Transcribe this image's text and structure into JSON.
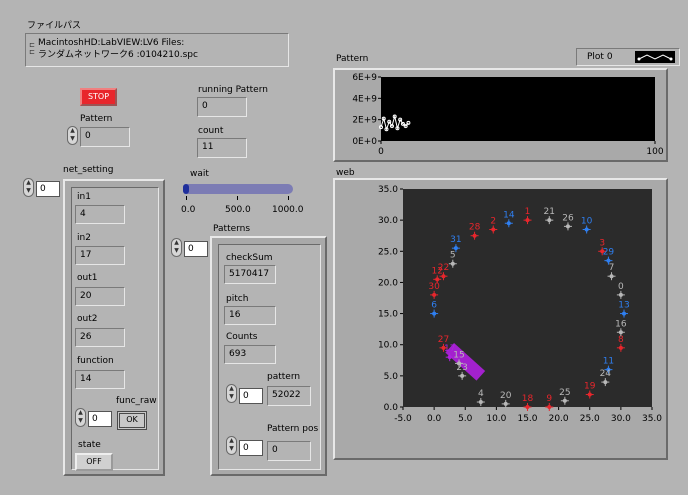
{
  "file_path": {
    "label": "ファイルパス",
    "lines": [
      "MacintoshHD:LabVIEW:LV6 Files:",
      "ランダムネットワーク6 :0104210.spc"
    ]
  },
  "stop_button": {
    "label": "STOP"
  },
  "running_pattern": {
    "label": "running Pattern",
    "value": "0"
  },
  "count": {
    "label": "count",
    "value": "11"
  },
  "pattern_control": {
    "label": "Pattern",
    "value": "0"
  },
  "net_setting": {
    "label": "net_setting",
    "index": "0",
    "in1": {
      "label": "in1",
      "value": "4"
    },
    "in2": {
      "label": "in2",
      "value": "17"
    },
    "out1": {
      "label": "out1",
      "value": "20"
    },
    "out2": {
      "label": "out2",
      "value": "26"
    },
    "function": {
      "label": "function",
      "value": "14"
    },
    "func_raw": {
      "label": "func_raw",
      "value": "0",
      "ok_label": "OK"
    },
    "state": {
      "label": "state",
      "value": "OFF"
    }
  },
  "wait": {
    "label": "wait",
    "ticks": [
      "0.0",
      "500.0",
      "1000.0"
    ],
    "value_fraction": 0.0
  },
  "patterns": {
    "label": "Patterns",
    "index": "0",
    "checksum": {
      "label": "checkSum",
      "value": "5170417"
    },
    "pitch": {
      "label": "pitch",
      "value": "16"
    },
    "counts": {
      "label": "Counts",
      "value": "693"
    },
    "pattern": {
      "label": "pattern",
      "index": "0",
      "value": "52022"
    },
    "pattern_pos": {
      "label": "Pattern pos",
      "index": "0",
      "value": "0"
    }
  },
  "pattern_graph": {
    "label": "Pattern",
    "plot_legend": "Plot 0"
  },
  "web_graph": {
    "label": "web"
  },
  "chart_data": [
    {
      "type": "line",
      "title": "Pattern",
      "xlabel": "",
      "ylabel": "",
      "xlim": [
        0,
        100
      ],
      "ylim": [
        0,
        6000000000.0
      ],
      "x_tick_labels": [
        "0",
        "100"
      ],
      "y_tick_labels": [
        "0E+0",
        "2E+9",
        "4E+9",
        "6E+9"
      ],
      "series": [
        {
          "name": "Plot 0",
          "x": [
            0,
            1,
            2,
            3,
            4,
            5,
            6,
            7,
            8,
            9,
            10
          ],
          "y": [
            1300000000.0,
            2100000000.0,
            1100000000.0,
            1800000000.0,
            1400000000.0,
            2300000000.0,
            1200000000.0,
            2000000000.0,
            1600000000.0,
            1400000000.0,
            1700000000.0
          ]
        }
      ],
      "background": "#000000",
      "line_color": "#ffffff"
    },
    {
      "type": "scatter",
      "title": "web",
      "xlim": [
        -5,
        35
      ],
      "ylim": [
        0,
        35
      ],
      "x_tick_labels": [
        "-5.0",
        "0.0",
        "5.0",
        "10.0",
        "15.0",
        "20.0",
        "25.0",
        "30.0",
        "35.0"
      ],
      "y_tick_labels": [
        "0.0",
        "5.0",
        "10.0",
        "15.0",
        "20.0",
        "25.0",
        "30.0",
        "35.0"
      ],
      "grid": false,
      "background": "#2b2b2b",
      "colors": {
        "red": "#e8262c",
        "blue": "#2f7ff0",
        "gray": "#b8b8b8",
        "purple": "#b020e0"
      },
      "points": [
        {
          "id": "0",
          "x": 30.0,
          "y": 18.0,
          "color": "gray"
        },
        {
          "id": "1",
          "x": 15.0,
          "y": 30.0,
          "color": "red"
        },
        {
          "id": "2",
          "x": 9.5,
          "y": 28.5,
          "color": "red"
        },
        {
          "id": "3",
          "x": 27.0,
          "y": 25.0,
          "color": "red"
        },
        {
          "id": "4",
          "x": 7.5,
          "y": 0.8,
          "color": "gray"
        },
        {
          "id": "5",
          "x": 3.0,
          "y": 23.0,
          "color": "gray"
        },
        {
          "id": "6",
          "x": 0.0,
          "y": 15.0,
          "color": "blue"
        },
        {
          "id": "7",
          "x": 28.5,
          "y": 21.0,
          "color": "gray"
        },
        {
          "id": "8",
          "x": 30.0,
          "y": 9.5,
          "color": "red"
        },
        {
          "id": "9",
          "x": 18.5,
          "y": 0.0,
          "color": "red"
        },
        {
          "id": "10",
          "x": 24.5,
          "y": 28.5,
          "color": "blue"
        },
        {
          "id": "11",
          "x": 28.0,
          "y": 6.0,
          "color": "blue"
        },
        {
          "id": "12",
          "x": 0.5,
          "y": 20.5,
          "color": "red"
        },
        {
          "id": "13",
          "x": 30.5,
          "y": 15.0,
          "color": "blue"
        },
        {
          "id": "14",
          "x": 12.0,
          "y": 29.5,
          "color": "blue"
        },
        {
          "id": "15",
          "x": 4.0,
          "y": 7.0,
          "color": "gray"
        },
        {
          "id": "16",
          "x": 30.0,
          "y": 12.0,
          "color": "gray"
        },
        {
          "id": "17",
          "x": 2.5,
          "y": 8.0,
          "color": "purple"
        },
        {
          "id": "18",
          "x": 15.0,
          "y": 0.0,
          "color": "red"
        },
        {
          "id": "19",
          "x": 25.0,
          "y": 2.0,
          "color": "red"
        },
        {
          "id": "20",
          "x": 11.5,
          "y": 0.5,
          "color": "gray"
        },
        {
          "id": "21",
          "x": 18.5,
          "y": 30.0,
          "color": "gray"
        },
        {
          "id": "22",
          "x": 1.5,
          "y": 21.0,
          "color": "red"
        },
        {
          "id": "23",
          "x": 4.5,
          "y": 5.0,
          "color": "gray"
        },
        {
          "id": "24",
          "x": 27.5,
          "y": 4.0,
          "color": "gray"
        },
        {
          "id": "25",
          "x": 21.0,
          "y": 1.0,
          "color": "gray"
        },
        {
          "id": "26",
          "x": 21.5,
          "y": 29.0,
          "color": "gray"
        },
        {
          "id": "27",
          "x": 1.5,
          "y": 9.5,
          "color": "red"
        },
        {
          "id": "28",
          "x": 6.5,
          "y": 27.5,
          "color": "red"
        },
        {
          "id": "29",
          "x": 28.0,
          "y": 23.5,
          "color": "blue"
        },
        {
          "id": "30",
          "x": 0.0,
          "y": 18.0,
          "color": "red"
        },
        {
          "id": "31",
          "x": 3.5,
          "y": 25.5,
          "color": "blue"
        }
      ],
      "highlight_band": {
        "from": [
          2.5,
          9.5
        ],
        "to": [
          7.5,
          5.0
        ],
        "color": "purple"
      }
    }
  ]
}
